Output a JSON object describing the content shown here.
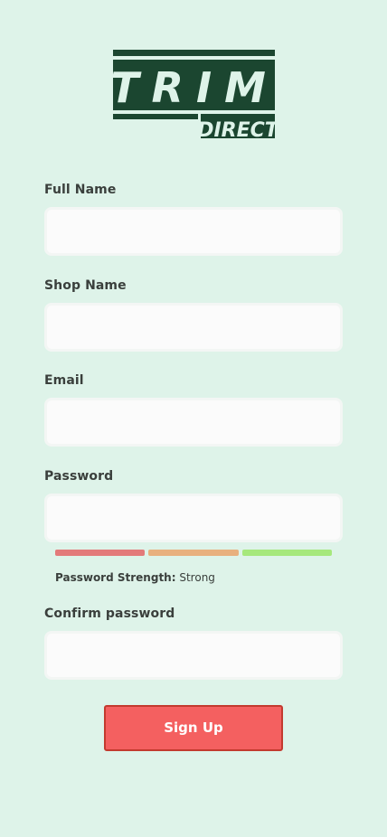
{
  "brand": {
    "line1": "TRIM",
    "line2": "DIRECT",
    "color": "#1b4630"
  },
  "form": {
    "full_name": {
      "label": "Full Name",
      "value": ""
    },
    "shop_name": {
      "label": "Shop Name",
      "value": ""
    },
    "email": {
      "label": "Email",
      "value": ""
    },
    "password": {
      "label": "Password",
      "value": ""
    },
    "confirm_password": {
      "label": "Confirm password",
      "value": ""
    },
    "strength": {
      "prefix": "Password Strength:",
      "value": "Strong",
      "level": 3,
      "max": 3,
      "colors": [
        "#e37a7a",
        "#e8b07e",
        "#a6e87c"
      ]
    },
    "submit_label": "Sign Up"
  },
  "colors": {
    "background": "#def3e9",
    "button": "#f46060",
    "button_border": "#c33a2f"
  }
}
